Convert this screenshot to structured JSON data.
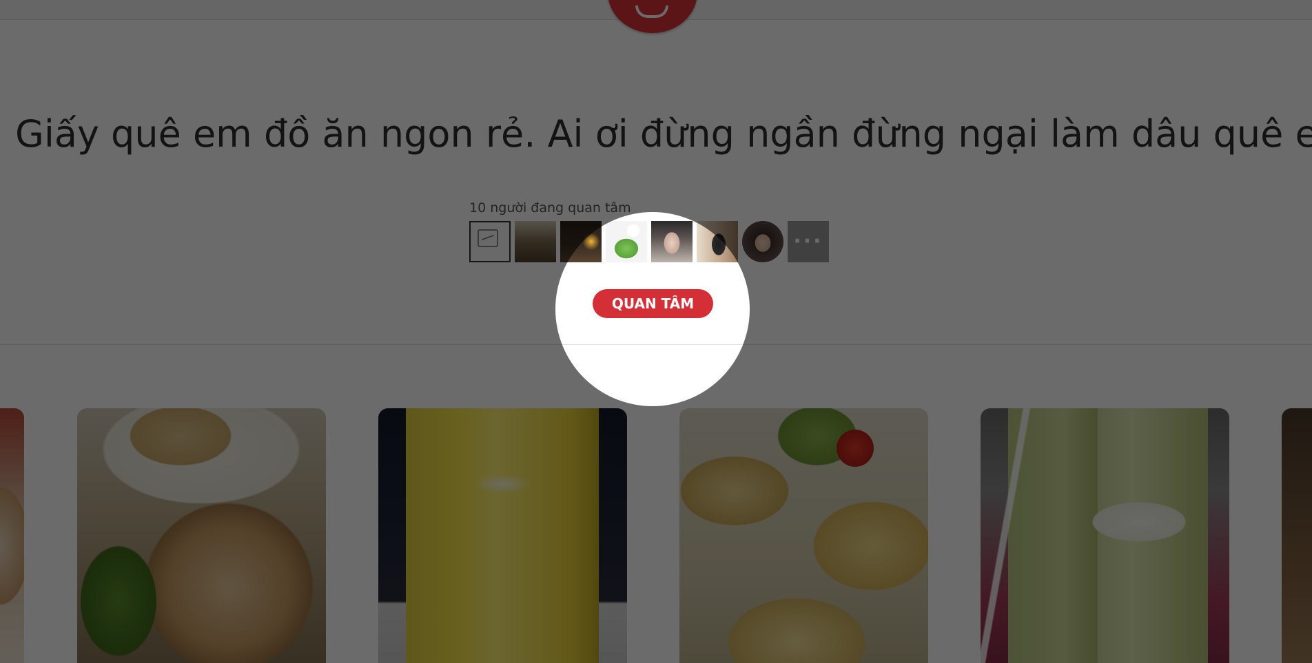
{
  "header": {
    "logo_icon": "brand-logo-icon"
  },
  "page": {
    "tagline": "Giấy quê em đồ ăn ngon rẻ. Ai ơi đừng ngần đừng ngại làm dâu quê em"
  },
  "followers": {
    "count_label": "10 người đang quan tâm",
    "more_label": "···",
    "avatars": [
      {
        "kind": "placeholder",
        "color": "#fafafa"
      },
      {
        "kind": "photo",
        "color": "#7a6a4e"
      },
      {
        "kind": "photo",
        "color": "#3a2e22"
      },
      {
        "kind": "photo",
        "color": "#7fc25a"
      },
      {
        "kind": "photo",
        "color": "#9b8c84"
      },
      {
        "kind": "photo",
        "color": "#c2a58a"
      },
      {
        "kind": "photo",
        "color": "#5a4a45"
      }
    ]
  },
  "actions": {
    "follow_label": "QUAN TÂM",
    "follow_color": "#d42f36"
  },
  "colors": {
    "brand": "#d93438",
    "overlay": "rgba(0,0,0,0.58)"
  }
}
